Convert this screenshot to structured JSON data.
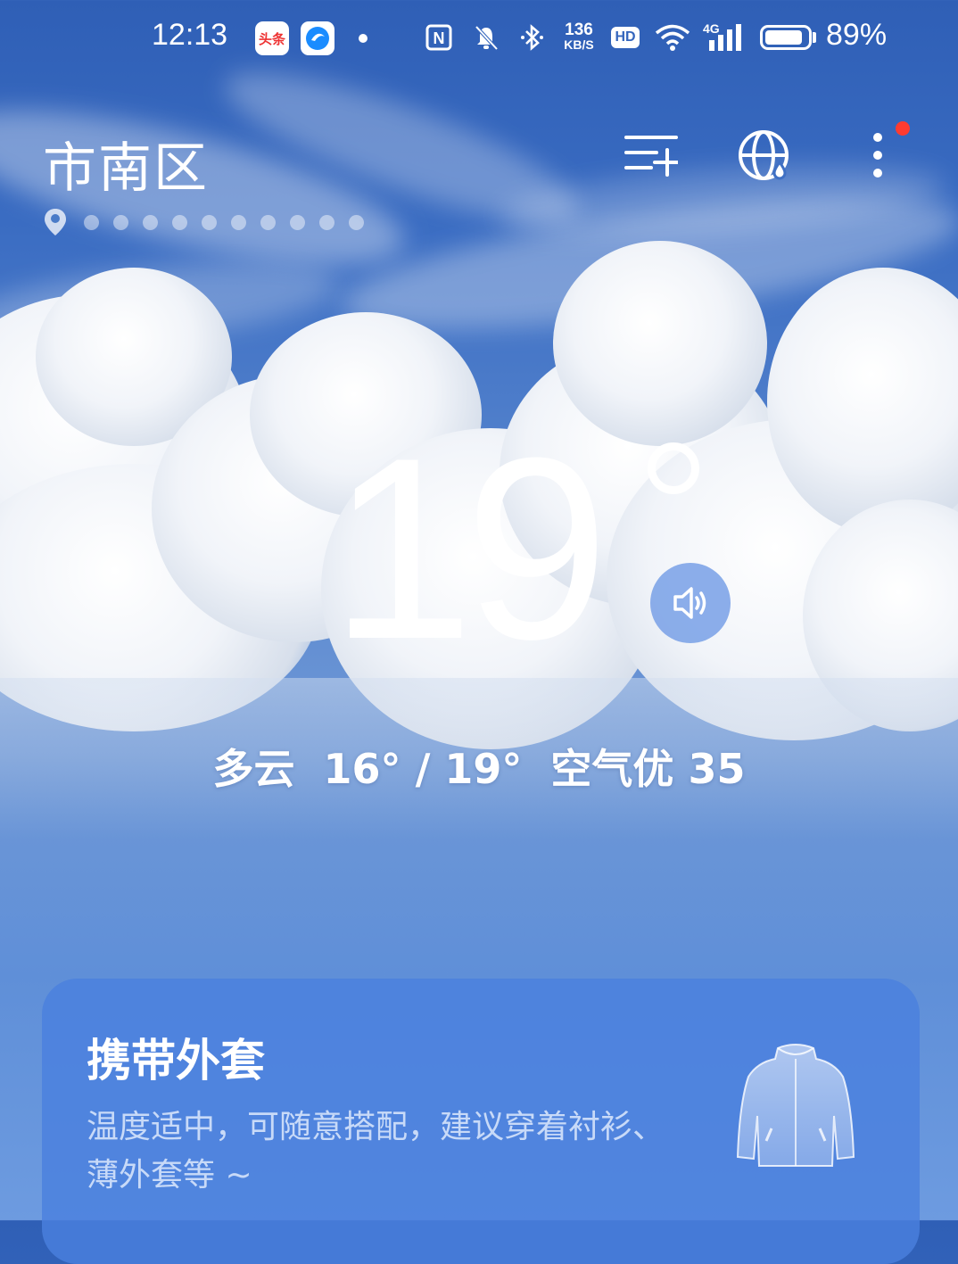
{
  "status_bar": {
    "time": "12:13",
    "app_icons": [
      "toutiao-icon",
      "browser-icon"
    ],
    "nfc": "N",
    "net_speed_top": "136",
    "net_speed_bottom": "KB/S",
    "hd": "HD",
    "network": "4G",
    "battery_percent": "89%",
    "battery_level": 0.89
  },
  "header": {
    "city": "市南区",
    "page_dots": 10
  },
  "weather": {
    "temperature": "19",
    "summary": "多云  16° / 19°  空气优 35"
  },
  "card": {
    "title": "携带外套",
    "description": "温度适中，可随意搭配，建议穿着衬衫、薄外套等 ~"
  },
  "colors": {
    "accent_red": "#ff3b30",
    "card_bg": "#4a80de",
    "sky_top": "#2f5fb6"
  }
}
